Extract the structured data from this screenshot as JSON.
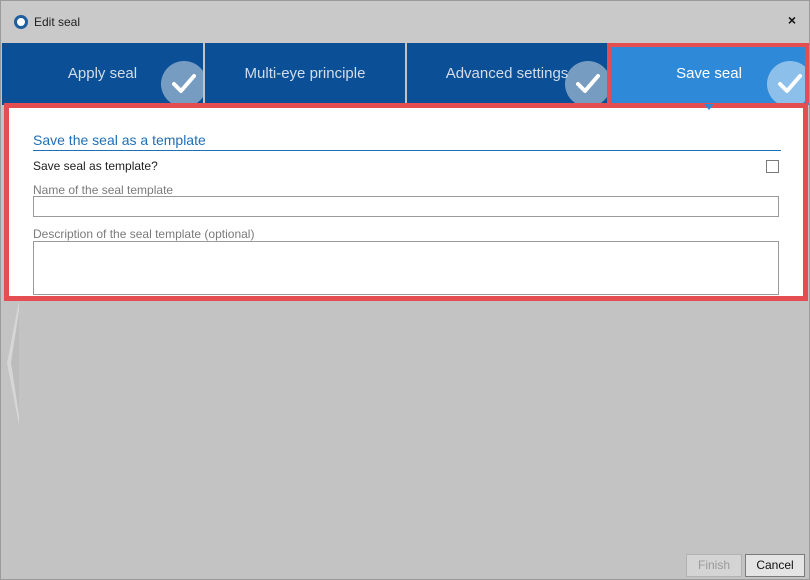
{
  "window": {
    "title": "Edit seal",
    "close_glyph": "×",
    "icon": "seal-ring-icon"
  },
  "tabs": [
    {
      "label": "Apply seal",
      "icon": "checkmark-icon",
      "active": false
    },
    {
      "label": "Multi-eye principle",
      "icon": "checkmark-icon",
      "active": false
    },
    {
      "label": "Advanced settings",
      "icon": "checkmark-icon",
      "active": false
    },
    {
      "label": "Save seal",
      "icon": "checkmark-icon",
      "active": true
    }
  ],
  "panel": {
    "section_title": "Save the seal as a template",
    "save_checkbox_label": "Save seal as template?",
    "save_checkbox_checked": false,
    "name_label": "Name of the seal template",
    "name_value": "",
    "description_label": "Description of the seal template (optional)",
    "description_value": ""
  },
  "footer": {
    "finish_label": "Finish",
    "finish_enabled": false,
    "cancel_label": "Cancel"
  },
  "colors": {
    "tab_inactive": "#0b4f96",
    "tab_active": "#2e8ad9",
    "highlight": "#e54e50",
    "section_title": "#1e6fb8"
  }
}
